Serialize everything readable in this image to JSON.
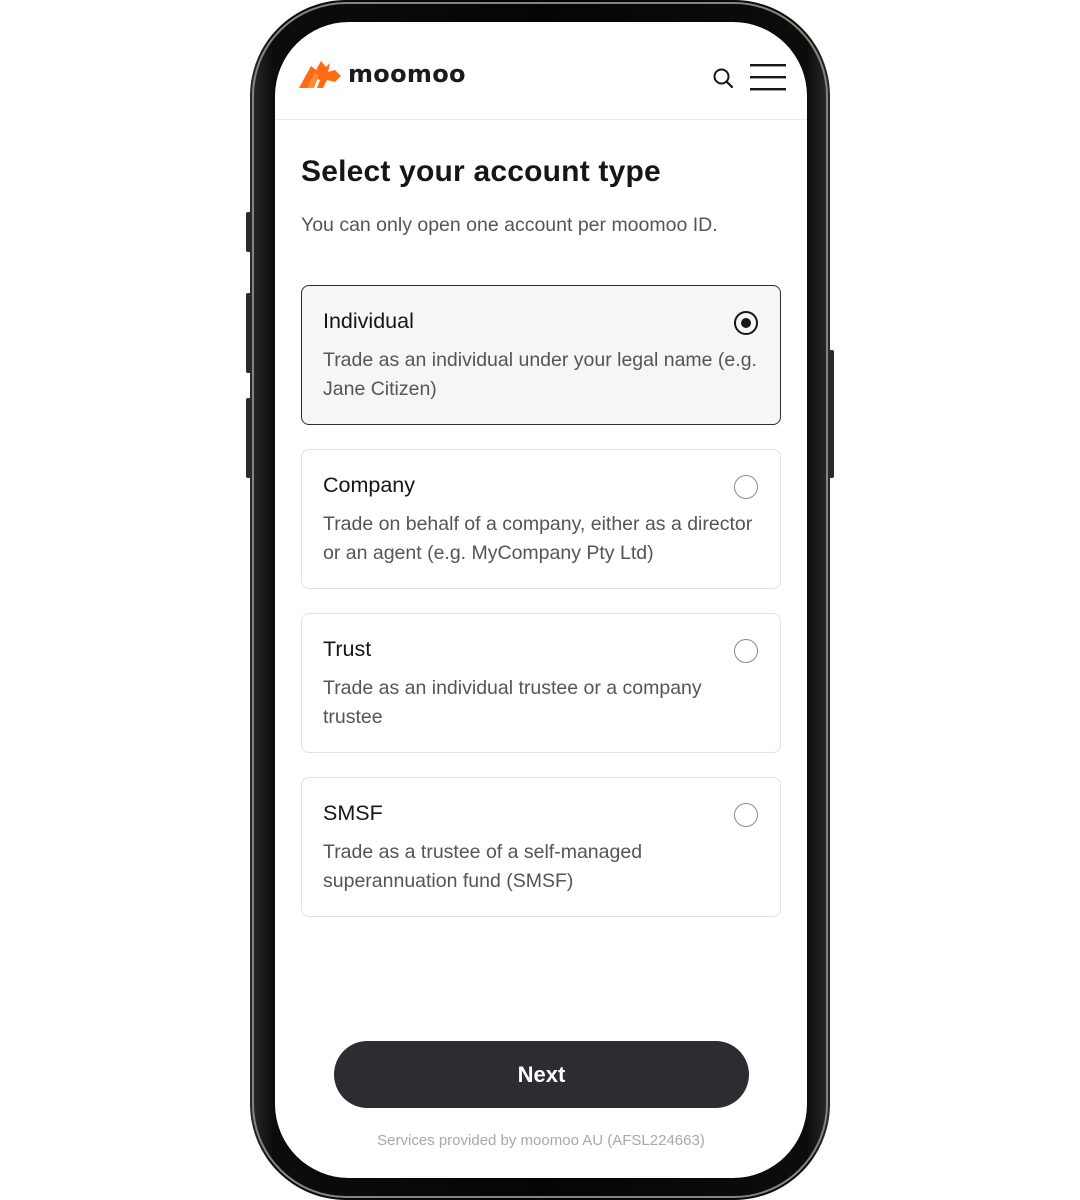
{
  "header": {
    "brand": "moomoo",
    "brand_color": "#ff6a13"
  },
  "page": {
    "title": "Select your account type",
    "subtitle": "You can only open one account per moomoo ID."
  },
  "options": [
    {
      "title": "Individual",
      "description": "Trade as an individual under your legal name (e.g. Jane Citizen)",
      "selected": true
    },
    {
      "title": "Company",
      "description": "Trade on behalf of a company, either as a director or an agent (e.g. MyCompany Pty Ltd)",
      "selected": false
    },
    {
      "title": "Trust",
      "description": "Trade as an individual trustee or a company trustee",
      "selected": false
    },
    {
      "title": "SMSF",
      "description": "Trade as a trustee of a self-managed superannuation fund (SMSF)",
      "selected": false
    }
  ],
  "actions": {
    "next_label": "Next"
  },
  "footer": {
    "note": "Services provided by moomoo AU (AFSL224663)"
  },
  "icons": {
    "logo": "moomoo-bull-logo-icon",
    "search": "search-icon",
    "menu": "hamburger-menu-icon",
    "radio_selected": "radio-selected-icon",
    "radio_unselected": "radio-unselected-icon"
  }
}
